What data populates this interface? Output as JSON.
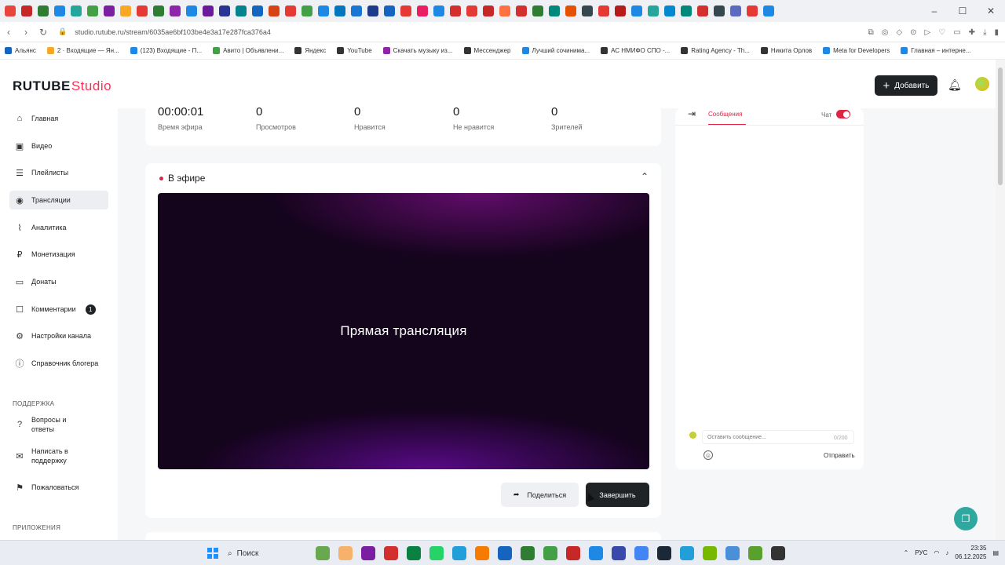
{
  "browser": {
    "url": "studio.rutube.ru/stream/6035ae6bf103be4e3a17e287fca376a4",
    "bookmarks": [
      "Альянс",
      "2 · Входящие — Ян...",
      "(123) Входящие - П...",
      "Авито | Объявлени...",
      "Яндекс",
      "YouTube",
      "Скачать музыку из...",
      "Мессенджер",
      "Лучший сочинима...",
      "АС НМИФО СПО -...",
      "Rating Agency - Th...",
      "Никита Орлов",
      "Meta for Developers",
      "Главная – интерне..."
    ]
  },
  "header": {
    "logo_main": "RUTUBE",
    "logo_studio": "Studio",
    "add_label": "Добавить"
  },
  "sidebar": {
    "items": [
      {
        "label": "Главная",
        "icon": "home-icon"
      },
      {
        "label": "Видео",
        "icon": "video-icon"
      },
      {
        "label": "Плейлисты",
        "icon": "playlist-icon"
      },
      {
        "label": "Трансляции",
        "icon": "broadcast-icon"
      },
      {
        "label": "Аналитика",
        "icon": "analytics-icon"
      },
      {
        "label": "Монетизация",
        "icon": "ruble-icon"
      },
      {
        "label": "Донаты",
        "icon": "donate-icon"
      },
      {
        "label": "Комментарии",
        "icon": "comment-icon",
        "badge": "1"
      },
      {
        "label": "Настройки канала",
        "icon": "gear-icon"
      },
      {
        "label": "Справочник блогера",
        "icon": "info-icon"
      }
    ],
    "support_heading": "ПОДДЕРЖКА",
    "support_items": [
      {
        "label": "Вопросы и ответы",
        "icon": "question-icon"
      },
      {
        "label": "Написать в поддержку",
        "icon": "mail-icon"
      },
      {
        "label": "Пожаловаться",
        "icon": "flag-icon"
      }
    ],
    "apps_heading": "ПРИЛОЖЕНИЯ"
  },
  "stats": [
    {
      "value": "00:00:01",
      "label": "Время эфира"
    },
    {
      "value": "0",
      "label": "Просмотров"
    },
    {
      "value": "0",
      "label": "Нравится"
    },
    {
      "value": "0",
      "label": "Не нравится"
    },
    {
      "value": "0",
      "label": "Зрителей"
    }
  ],
  "live": {
    "heading": "В эфире",
    "player_text": "Прямая трансляция",
    "share_label": "Поделиться",
    "end_label": "Завершить"
  },
  "chat": {
    "tab_messages": "Сообщения",
    "chat_label": "Чат",
    "input_placeholder": "Оставить сообщение...",
    "counter": "0/200",
    "send_label": "Отправить"
  },
  "taskbar": {
    "search_label": "Поиск",
    "lang": "РУС",
    "time": "23:35",
    "date": "06.12.2025"
  },
  "colors": {
    "accent": "#e02443",
    "dark_button": "#1f2326",
    "active_nav": "#eceef1"
  }
}
